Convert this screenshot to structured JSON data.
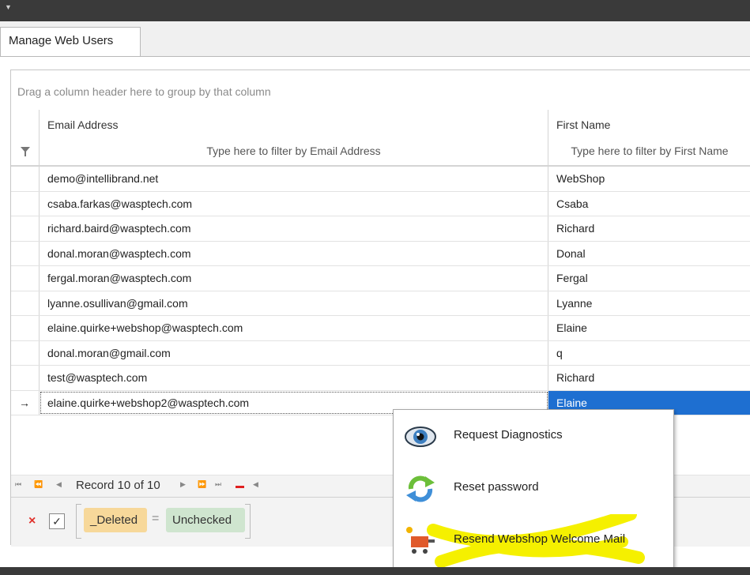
{
  "tab": {
    "label": "Manage  Web  Users"
  },
  "grid": {
    "group_hint": "Drag a column header here to group by that column",
    "columns": [
      "Email Address",
      "First Name"
    ],
    "filter_placeholders": [
      "Type here to filter by Email Address",
      "Type here to filter by First Name"
    ],
    "rows": [
      [
        "demo@intellibrand.net",
        "WebShop"
      ],
      [
        "csaba.farkas@wasptech.com",
        "Csaba"
      ],
      [
        "richard.baird@wasptech.com",
        "Richard"
      ],
      [
        "donal.moran@wasptech.com",
        "Donal"
      ],
      [
        "fergal.moran@wasptech.com",
        "Fergal"
      ],
      [
        "lyanne.osullivan@gmail.com",
        "Lyanne"
      ],
      [
        "elaine.quirke+webshop@wasptech.com",
        "Elaine"
      ],
      [
        "donal.moran@gmail.com",
        "q"
      ],
      [
        "test@wasptech.com",
        "Richard"
      ],
      [
        "elaine.quirke+webshop2@wasptech.com",
        "Elaine"
      ]
    ],
    "focused_row_arrow": "→"
  },
  "navigator": {
    "record_text": "Record 10 of 10"
  },
  "filter_panel": {
    "close": "×",
    "check": "✓",
    "field": "_Deleted",
    "operator": "=",
    "value": "Unchecked"
  },
  "context_menu": {
    "items": [
      {
        "label": "Request Diagnostics",
        "icon": "eye-icon"
      },
      {
        "label": "Reset password",
        "icon": "refresh-arrows-icon"
      },
      {
        "label": "Resend Webshop Welcome Mail",
        "icon": "cart-icon"
      }
    ]
  },
  "colors": {
    "selection": "#1e6fd1",
    "highlight": "#f5f000",
    "field_badge": "#f7d89a",
    "value_badge": "#cfe5cf"
  }
}
